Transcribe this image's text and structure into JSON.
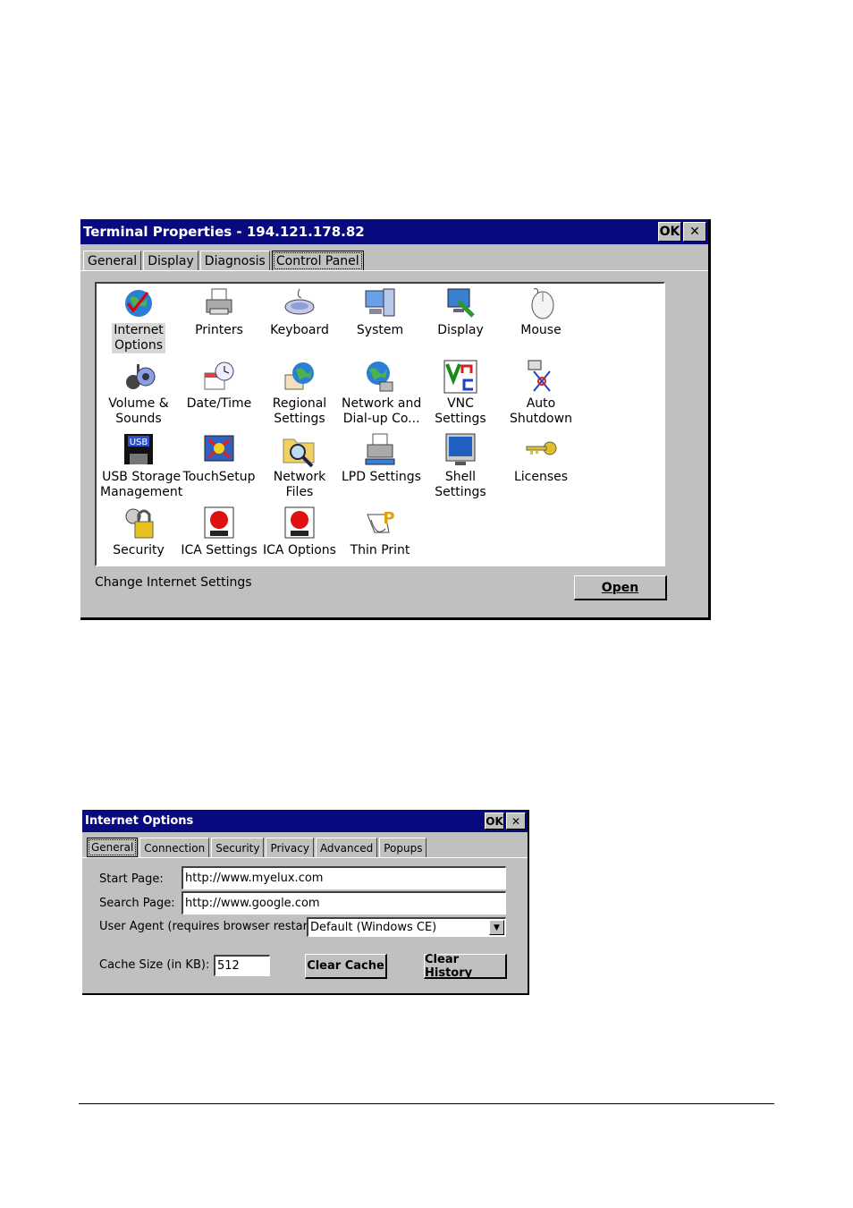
{
  "terminal_window": {
    "title": "Terminal Properties - 194.121.178.82",
    "ok_label": "OK",
    "close_label": "✕",
    "tabs": [
      "General",
      "Display",
      "Diagnosis",
      "Control Panel"
    ],
    "items": [
      {
        "label": "Internet\nOptions",
        "icon": "internet-options-icon"
      },
      {
        "label": "Printers",
        "icon": "printer-icon"
      },
      {
        "label": "Keyboard",
        "icon": "keyboard-icon"
      },
      {
        "label": "System",
        "icon": "system-icon"
      },
      {
        "label": "Display",
        "icon": "display-icon"
      },
      {
        "label": "Mouse",
        "icon": "mouse-icon"
      },
      {
        "label": "Volume &\nSounds",
        "icon": "volume-icon"
      },
      {
        "label": "Date/Time",
        "icon": "date-time-icon"
      },
      {
        "label": "Regional\nSettings",
        "icon": "regional-settings-icon"
      },
      {
        "label": "Network and\nDial-up Co...",
        "icon": "network-icon"
      },
      {
        "label": "VNC\nSettings",
        "icon": "vnc-icon"
      },
      {
        "label": "Auto\nShutdown",
        "icon": "auto-shutdown-icon"
      },
      {
        "label": "USB Storage\nManagement",
        "icon": "usb-storage-icon"
      },
      {
        "label": "TouchSetup",
        "icon": "touch-setup-icon"
      },
      {
        "label": "Network\nFiles",
        "icon": "network-files-icon"
      },
      {
        "label": "LPD Settings",
        "icon": "lpd-settings-icon"
      },
      {
        "label": "Shell\nSettings",
        "icon": "shell-settings-icon"
      },
      {
        "label": "Licenses",
        "icon": "licenses-icon"
      },
      {
        "label": "Security",
        "icon": "security-icon"
      },
      {
        "label": "ICA Settings",
        "icon": "ica-settings-icon"
      },
      {
        "label": "ICA Options",
        "icon": "ica-options-icon"
      },
      {
        "label": "Thin Print",
        "icon": "thin-print-icon"
      }
    ],
    "status_text": "Change Internet Settings",
    "open_label": "Open"
  },
  "internet_window": {
    "title": "Internet Options",
    "ok_label": "OK",
    "close_label": "✕",
    "tabs": [
      "General",
      "Connection",
      "Security",
      "Privacy",
      "Advanced",
      "Popups"
    ],
    "start_page_label": "Start Page:",
    "start_page_value": "http://www.myelux.com",
    "search_page_label": "Search Page:",
    "search_page_value": "http://www.google.com",
    "user_agent_label": "User Agent (requires browser restart):",
    "user_agent_value": "Default (Windows CE)",
    "cache_label": "Cache Size (in KB):",
    "cache_value": "512",
    "clear_cache_label": "Clear Cache",
    "clear_history_label": "Clear History"
  }
}
